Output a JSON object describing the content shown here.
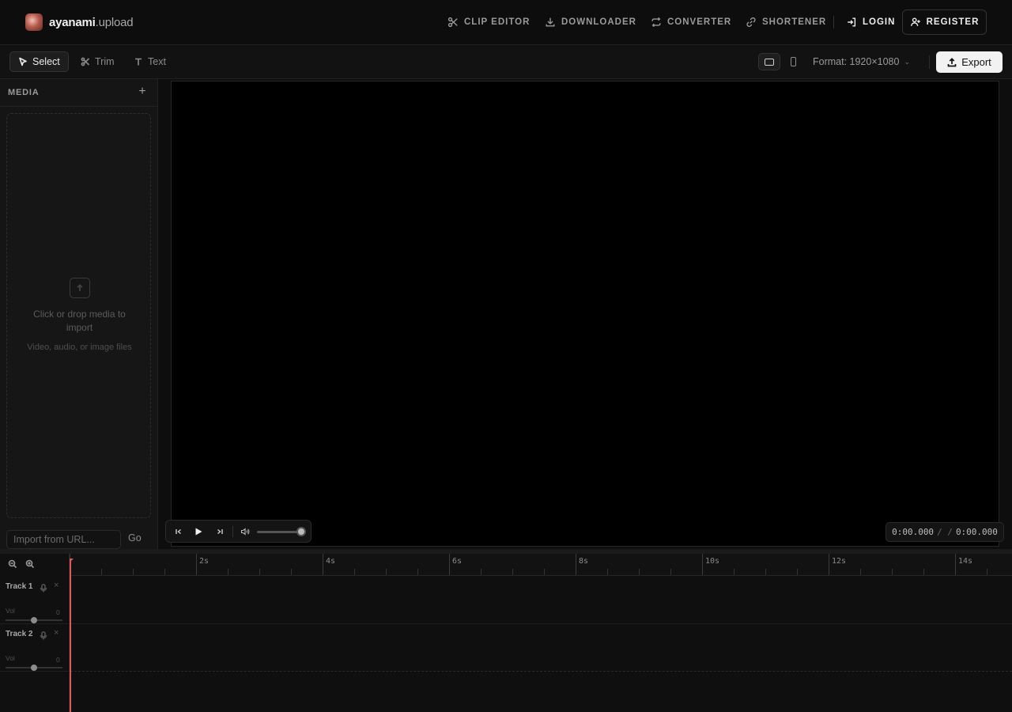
{
  "brand": {
    "name_bold": "ayanami",
    "name_dim": ".upload"
  },
  "nav": {
    "clip_editor": "CLIP EDITOR",
    "downloader": "DOWNLOADER",
    "converter": "CONVERTER",
    "shortener": "SHORTENER",
    "login": "LOGIN",
    "register": "REGISTER"
  },
  "toolbar": {
    "tools": [
      "Select",
      "Trim",
      "Text"
    ],
    "active_tool": "Select",
    "format_label": "Format: 1920×1080",
    "export_label": "Export"
  },
  "media": {
    "title": "MEDIA",
    "add_icon": "plus-icon",
    "dropzone_text": "Click or drop media to import",
    "dropzone_sub": "Video, audio, or image files",
    "url_placeholder": "Import from URL...",
    "go_label": "Go"
  },
  "player": {
    "current_time": "0:00.000",
    "separator": "/ /",
    "total_time": "0:00.000",
    "volume": 1.0
  },
  "timeline": {
    "ruler_labels": [
      "2s",
      "4s",
      "6s",
      "8s",
      "10s",
      "12s",
      "14s"
    ],
    "tracks": [
      {
        "name": "Track 1",
        "vol_label": "Vol",
        "vol_value": "0"
      },
      {
        "name": "Track 2",
        "vol_label": "Vol",
        "vol_value": "0"
      }
    ]
  },
  "colors": {
    "background": "#0d0d0d",
    "playhead": "#e05a5a",
    "export_bg": "#f2f2f2"
  }
}
